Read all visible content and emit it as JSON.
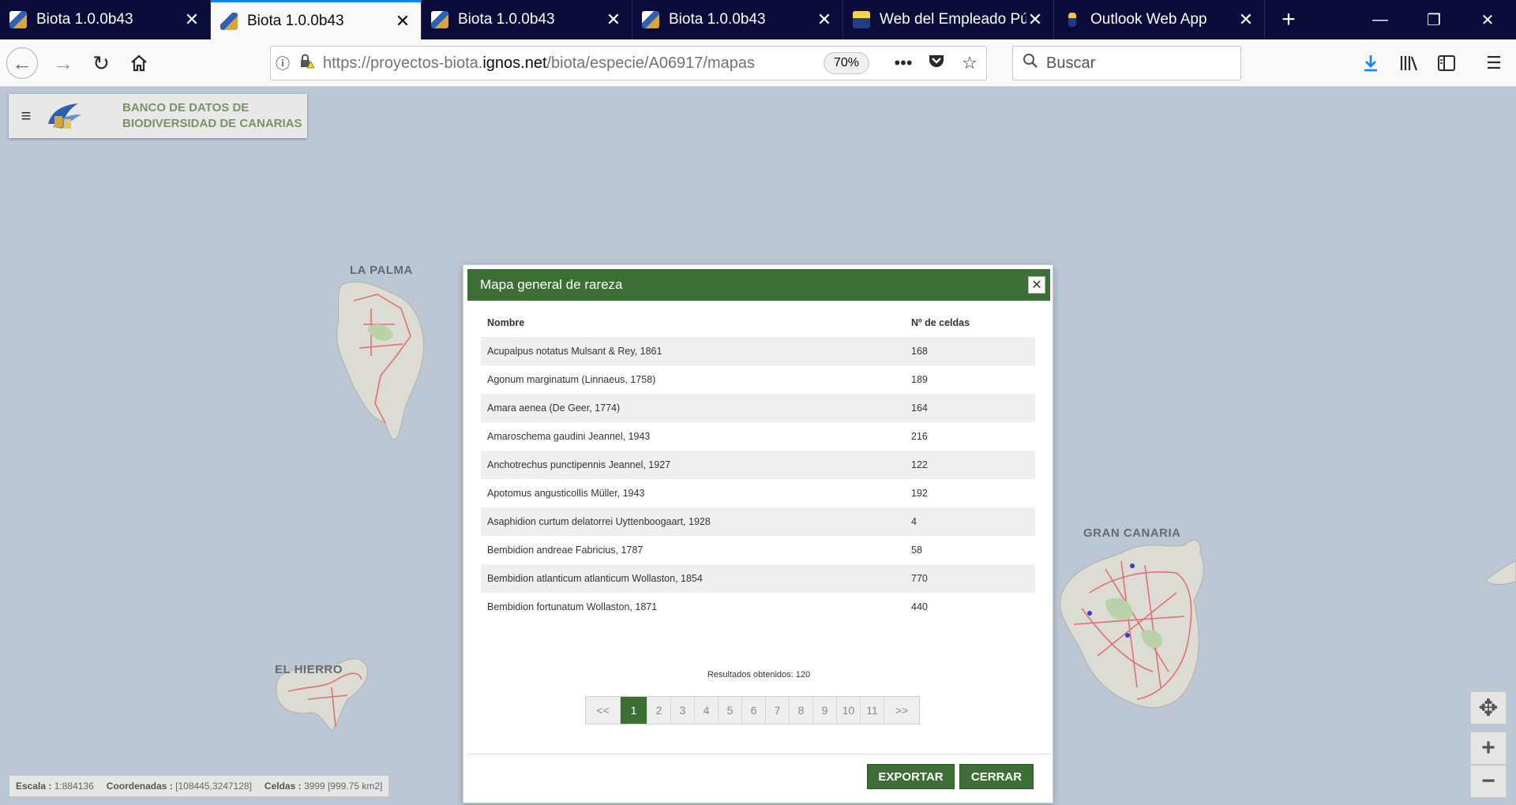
{
  "tabs": [
    {
      "title": "Biota 1.0.0b43",
      "active": false,
      "icon": "biota-favicon"
    },
    {
      "title": "Biota 1.0.0b43",
      "active": true,
      "icon": "biota-favicon"
    },
    {
      "title": "Biota 1.0.0b43",
      "active": false,
      "icon": "biota-favicon"
    },
    {
      "title": "Biota 1.0.0b43",
      "active": false,
      "icon": "biota-favicon"
    },
    {
      "title": "Web del Empleado Pú",
      "active": false,
      "icon": "empleado-favicon"
    },
    {
      "title": "Outlook Web App",
      "active": false,
      "icon": "outlook-favicon"
    }
  ],
  "navbar": {
    "url_prefix": "https://proyectos-biota.",
    "url_domain": "ignos.net",
    "url_path": "/biota/especie/A06917/mapas",
    "zoom": "70%",
    "search_placeholder": "Buscar"
  },
  "map": {
    "brand_line1": "BANCO DE DATOS DE",
    "brand_line2": "BIODIVERSIDAD DE CANARIAS",
    "islands": [
      "LA PALMA",
      "EL HIERRO",
      "GRAN CANARIA"
    ],
    "scale_label": "Escala :",
    "scale_value": "1:884136",
    "coords_label": "Coordenadas :",
    "coords_value": "[108445,3247128]",
    "cells_label": "Celdas :",
    "cells_value": "3999 [999.75 km2]"
  },
  "modal": {
    "title": "Mapa general de rareza",
    "columns": [
      "Nombre",
      "Nº de celdas"
    ],
    "rows": [
      {
        "name": "Acupalpus notatus Mulsant & Rey, 1861",
        "cells": "168"
      },
      {
        "name": "Agonum marginatum (Linnaeus, 1758)",
        "cells": "189"
      },
      {
        "name": "Amara aenea (De Geer, 1774)",
        "cells": "164"
      },
      {
        "name": "Amaroschema gaudini Jeannel, 1943",
        "cells": "216"
      },
      {
        "name": "Anchotrechus punctipennis Jeannel, 1927",
        "cells": "122"
      },
      {
        "name": "Apotomus angusticollis Müller, 1943",
        "cells": "192"
      },
      {
        "name": "Asaphidion curtum delatorrei Uyttenboogaart, 1928",
        "cells": "4"
      },
      {
        "name": "Bembidion andreae Fabricius, 1787",
        "cells": "58"
      },
      {
        "name": "Bembidion atlanticum atlanticum Wollaston, 1854",
        "cells": "770"
      },
      {
        "name": "Bembidion fortunatum Wollaston, 1871",
        "cells": "440"
      }
    ],
    "results": "Resultados obtenidos: 120",
    "pager": [
      "<<",
      "1",
      "2",
      "3",
      "4",
      "5",
      "6",
      "7",
      "8",
      "9",
      "10",
      "11",
      ">>"
    ],
    "pager_active": "1",
    "export_label": "EXPORTAR",
    "close_label": "CERRAR"
  },
  "colors": {
    "accent_green": "#3c6e36",
    "tabstrip": "#0c0c3a",
    "map_water": "#bcc7d5",
    "brand_text": "#7a9268"
  }
}
